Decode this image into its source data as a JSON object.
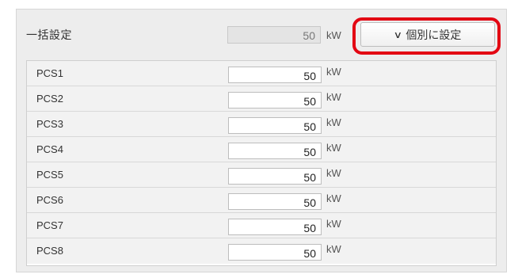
{
  "bulk": {
    "label": "一括設定",
    "value": "50",
    "unit": "kW",
    "button_chevron": "∨",
    "button_label": "個別に設定"
  },
  "pcs_rows": [
    {
      "label": "PCS1",
      "value": "50",
      "unit": "kW"
    },
    {
      "label": "PCS2",
      "value": "50",
      "unit": "kW"
    },
    {
      "label": "PCS3",
      "value": "50",
      "unit": "kW"
    },
    {
      "label": "PCS4",
      "value": "50",
      "unit": "kW"
    },
    {
      "label": "PCS5",
      "value": "50",
      "unit": "kW"
    },
    {
      "label": "PCS6",
      "value": "50",
      "unit": "kW"
    },
    {
      "label": "PCS7",
      "value": "50",
      "unit": "kW"
    },
    {
      "label": "PCS8",
      "value": "50",
      "unit": "kW"
    }
  ],
  "colors": {
    "highlight": "#e30613",
    "panel_bg": "#ededed",
    "row_bg": "#f2f2f2"
  }
}
